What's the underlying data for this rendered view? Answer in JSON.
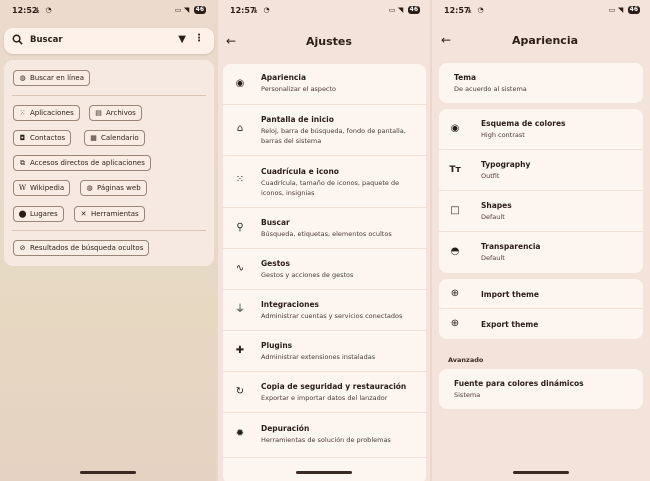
{
  "status": {
    "panel1_time": "12:52",
    "panel2_time": "12:57",
    "panel3_time": "12:57",
    "battery": "46"
  },
  "launcher": {
    "search_placeholder": "Buscar",
    "search_online": "Buscar en línea",
    "chips": {
      "apps": "Aplicaciones",
      "files": "Archivos",
      "contacts": "Contactos",
      "calendar": "Calendario",
      "shortcuts": "Accesos directos de aplicaciones",
      "wikipedia": "Wikipedia",
      "websites": "Páginas web",
      "places": "Lugares",
      "tools": "Herramientas",
      "hidden": "Resultados de búsqueda ocultos"
    }
  },
  "settings": {
    "title": "Ajustes",
    "items": [
      {
        "title": "Apariencia",
        "subtitle": "Personalizar el aspecto",
        "icon": "palette-icon"
      },
      {
        "title": "Pantalla de inicio",
        "subtitle": "Reloj, barra de búsqueda, fondo de pantalla, barras del sistema",
        "icon": "home-icon"
      },
      {
        "title": "Cuadrícula e icono",
        "subtitle": "Cuadrícula, tamaño de iconos, paquete de iconos, insignias",
        "icon": "grid-icon"
      },
      {
        "title": "Buscar",
        "subtitle": "Búsqueda, etiquetas, elementos ocultos",
        "icon": "search-icon"
      },
      {
        "title": "Gestos",
        "subtitle": "Gestos y acciones de gestos",
        "icon": "gesture-icon"
      },
      {
        "title": "Integraciones",
        "subtitle": "Administrar cuentas y servicios conectados",
        "icon": "plug-icon"
      },
      {
        "title": "Plugins",
        "subtitle": "Administrar extensiones instaladas",
        "icon": "puzzle-icon"
      },
      {
        "title": "Copia de seguridad y restauración",
        "subtitle": "Exportar e importar datos del lanzador",
        "icon": "restore-icon"
      },
      {
        "title": "Depuración",
        "subtitle": "Herramientas de solución de problemas",
        "icon": "bug-icon"
      }
    ]
  },
  "appearance": {
    "title": "Apariencia",
    "theme": {
      "title": "Tema",
      "subtitle": "De acuerdo al sistema"
    },
    "options": [
      {
        "title": "Esquema de colores",
        "subtitle": "High contrast",
        "icon": "palette-icon"
      },
      {
        "title": "Typography",
        "subtitle": "Outfit",
        "icon": "typography-icon"
      },
      {
        "title": "Shapes",
        "subtitle": "Default",
        "icon": "square-icon"
      },
      {
        "title": "Transparencia",
        "subtitle": "Default",
        "icon": "opacity-icon"
      }
    ],
    "import_theme": "Import theme",
    "export_theme": "Export theme",
    "advanced_section": "Avanzado",
    "dynamic_colors": {
      "title": "Fuente para colores dinámicos",
      "subtitle": "Sistema"
    }
  }
}
